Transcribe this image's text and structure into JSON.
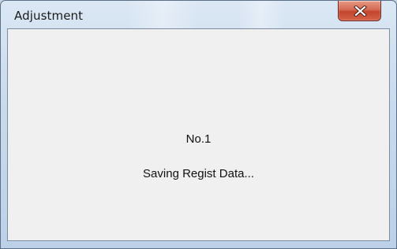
{
  "window": {
    "title": "Adjustment",
    "close_icon": "close-icon"
  },
  "message": {
    "line1": "No.1",
    "line2": "Saving Regist Data..."
  },
  "colors": {
    "frame": "#c9dbee",
    "client_bg": "#f0f0f0",
    "close_button": "#c7452c"
  }
}
